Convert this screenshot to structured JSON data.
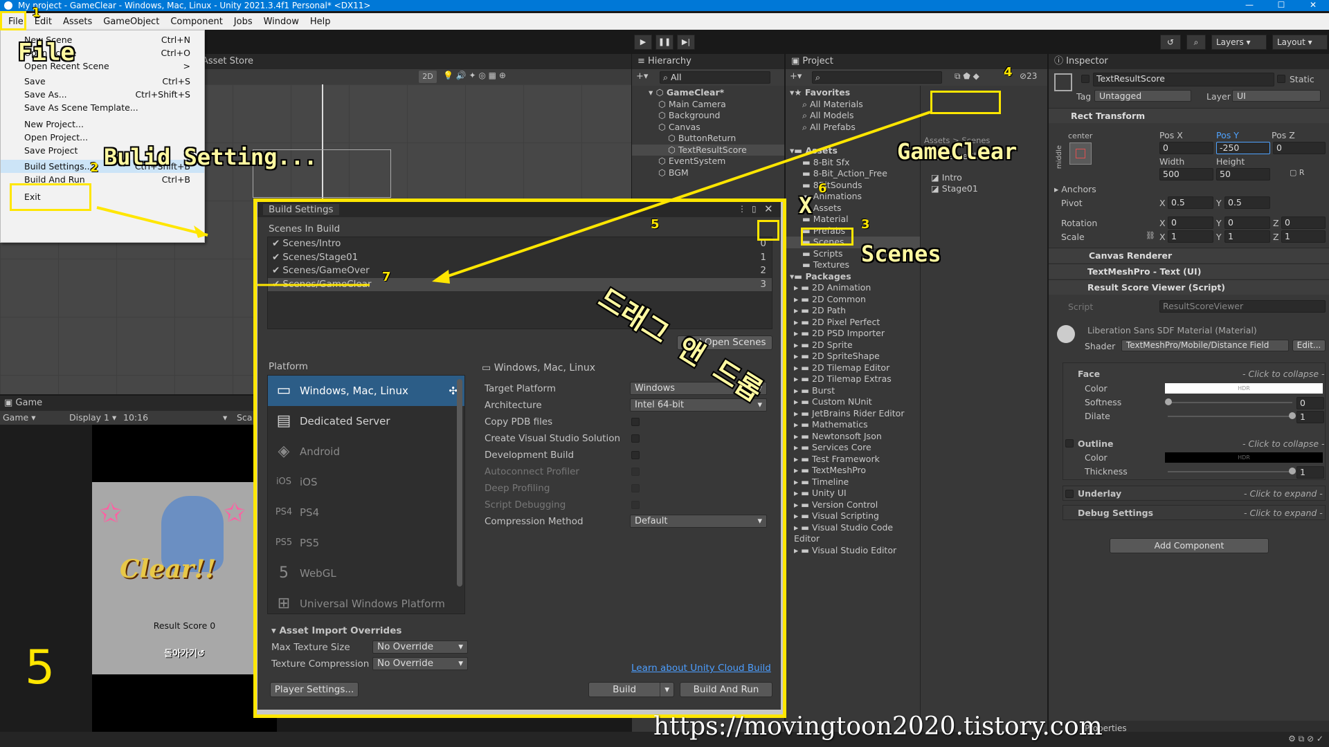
{
  "window": {
    "title": "My project - GameClear - Windows, Mac, Linux - Unity 2021.3.4f1 Personal* <DX11>"
  },
  "menu": [
    "File",
    "Edit",
    "Assets",
    "GameObject",
    "Component",
    "Jobs",
    "Window",
    "Help"
  ],
  "file_menu": {
    "items": [
      {
        "label": "New Scene",
        "shortcut": "Ctrl+N"
      },
      {
        "label": "Open Scene",
        "shortcut": "Ctrl+O"
      },
      {
        "label": "Open Recent Scene",
        "shortcut": ">"
      },
      {
        "label": "Save",
        "shortcut": "Ctrl+S"
      },
      {
        "label": "Save As...",
        "shortcut": "Ctrl+Shift+S"
      },
      {
        "label": "Save As Scene Template...",
        "shortcut": ""
      },
      {
        "label": "New Project...",
        "shortcut": ""
      },
      {
        "label": "Open Project...",
        "shortcut": ""
      },
      {
        "label": "Save Project",
        "shortcut": ""
      },
      {
        "label": "Build Settings...",
        "shortcut": "Ctrl+Shift+B"
      },
      {
        "label": "Build And Run",
        "shortcut": "Ctrl+B"
      },
      {
        "label": "Exit",
        "shortcut": ""
      }
    ]
  },
  "toolbar": {
    "layers": "Layers",
    "layout": "Layout"
  },
  "scene": {
    "asset_store_tab": "Asset Store",
    "mode_2d": "2D"
  },
  "hierarchy": {
    "tab": "Hierarchy",
    "search": "All",
    "items": [
      {
        "label": "GameClear*",
        "depth": 0
      },
      {
        "label": "Main Camera",
        "depth": 1
      },
      {
        "label": "Background",
        "depth": 1
      },
      {
        "label": "Canvas",
        "depth": 1
      },
      {
        "label": "ButtonReturn",
        "depth": 2
      },
      {
        "label": "TextResultScore",
        "depth": 2
      },
      {
        "label": "EventSystem",
        "depth": 1
      },
      {
        "label": "BGM",
        "depth": 1
      }
    ]
  },
  "project": {
    "tab": "Project",
    "count": "23",
    "breadcrumb": "Assets > Scenes",
    "favorites": [
      "Favorites",
      "All Materials",
      "All Models",
      "All Prefabs"
    ],
    "assets_root": "Assets",
    "assets": [
      "8-Bit Sfx",
      "8-Bit_Action_Free",
      "8BitSounds",
      "Animations",
      "Assets",
      "Material",
      "Prefabs",
      "Scenes",
      "Scripts",
      "Textures"
    ],
    "packages_root": "Packages",
    "packages": [
      "2D Animation",
      "2D Common",
      "2D Path",
      "2D Pixel Perfect",
      "2D PSD Importer",
      "2D Sprite",
      "2D SpriteShape",
      "2D Tilemap Editor",
      "2D Tilemap Extras",
      "Burst",
      "Custom NUnit",
      "JetBrains Rider Editor",
      "Mathematics",
      "Newtonsoft Json",
      "Services Core",
      "Test Framework",
      "TextMeshPro",
      "Timeline",
      "Unity UI",
      "Version Control",
      "Visual Scripting",
      "Visual Studio Code Editor",
      "Visual Studio Editor"
    ],
    "scene_files": [
      "GameClear",
      "Intro",
      "Stage01"
    ]
  },
  "inspector": {
    "tab": "Inspector",
    "object_name": "TextResultScore",
    "static": "Static",
    "tag_label": "Tag",
    "tag": "Untagged",
    "layer_label": "Layer",
    "layer": "UI",
    "rect_transform": "Rect Transform",
    "anchor_h": "center",
    "anchor_v": "middle",
    "pos_x_label": "Pos X",
    "pos_y_label": "Pos Y",
    "pos_z_label": "Pos Z",
    "pos_x": "0",
    "pos_y": "-250",
    "pos_z": "0",
    "width_label": "Width",
    "height_label": "Height",
    "width": "500",
    "height": "50",
    "anchors": "Anchors",
    "pivot": "Pivot",
    "pivot_x": "0.5",
    "pivot_y": "0.5",
    "rotation": "Rotation",
    "rot_x": "0",
    "rot_y": "0",
    "rot_z": "0",
    "scale": "Scale",
    "scale_x": "1",
    "scale_y": "1",
    "scale_z": "1",
    "canvas_renderer": "Canvas Renderer",
    "tmp": "TextMeshPro - Text (UI)",
    "result_viewer": "Result Score Viewer (Script)",
    "script_label": "Script",
    "script": "ResultScoreViewer",
    "material": "Liberation Sans SDF Material (Material)",
    "shader_label": "Shader",
    "shader": "TextMeshPro/Mobile/Distance Field",
    "edit": "Edit...",
    "face": "Face",
    "collapse": "- Click to collapse -",
    "expand": "- Click to expand -",
    "color": "Color",
    "hdr": "HDR",
    "softness": "Softness",
    "softness_val": "0",
    "dilate": "Dilate",
    "dilate_val": "1",
    "outline": "Outline",
    "thickness": "Thickness",
    "thickness_val": "1",
    "underlay": "Underlay",
    "debug": "Debug Settings",
    "add_component": "Add Component",
    "properties": "Properties"
  },
  "game": {
    "tab": "Game",
    "mode": "Game",
    "display": "Display 1",
    "ratio": "10:16",
    "scale": "Sca",
    "clear_text": "Clear!!",
    "result": "Result Score 0",
    "back": "돌아가기↺"
  },
  "build_settings": {
    "title": "Build Settings",
    "scenes_header": "Scenes In Build",
    "scenes": [
      {
        "name": "Scenes/Intro",
        "index": "0"
      },
      {
        "name": "Scenes/Stage01",
        "index": "1"
      },
      {
        "name": "Scenes/GameOver",
        "index": "2"
      },
      {
        "name": "Scenes/GameClear",
        "index": "3"
      }
    ],
    "add_open_scenes": "Add Open Scenes",
    "platform_header": "Platform",
    "platforms": [
      {
        "icon": "▭",
        "name": "Windows, Mac, Linux"
      },
      {
        "icon": "▤",
        "name": "Dedicated Server"
      },
      {
        "icon": "◈",
        "name": "Android"
      },
      {
        "icon": "iOS",
        "name": "iOS"
      },
      {
        "icon": "PS4",
        "name": "PS4"
      },
      {
        "icon": "PS5",
        "name": "PS5"
      },
      {
        "icon": "5",
        "name": "WebGL"
      },
      {
        "icon": "⊞",
        "name": "Universal Windows Platform"
      }
    ],
    "selected_platform": "Windows, Mac, Linux",
    "settings": [
      {
        "label": "Target Platform",
        "kind": "dropdown",
        "value": "Windows"
      },
      {
        "label": "Architecture",
        "kind": "dropdown",
        "value": "Intel 64-bit"
      },
      {
        "label": "Copy PDB files",
        "kind": "check",
        "value": ""
      },
      {
        "label": "Create Visual Studio Solution",
        "kind": "check",
        "value": ""
      },
      {
        "label": "Development Build",
        "kind": "check",
        "value": ""
      },
      {
        "label": "Autoconnect Profiler",
        "kind": "check-dim",
        "value": ""
      },
      {
        "label": "Deep Profiling",
        "kind": "check-dim",
        "value": ""
      },
      {
        "label": "Script Debugging",
        "kind": "check-dim",
        "value": ""
      },
      {
        "label": "Compression Method",
        "kind": "dropdown",
        "value": "Default"
      }
    ],
    "overrides_header": "Asset Import Overrides",
    "max_texture_label": "Max Texture Size",
    "max_texture": "No Override",
    "tex_compression_label": "Texture Compression",
    "tex_compression": "No Override",
    "cloud_link": "Learn about Unity Cloud Build",
    "player_settings": "Player Settings...",
    "build": "Build",
    "build_and_run": "Build And Run"
  },
  "annotations": {
    "file": "File",
    "build_setting": "Bulid Setting...",
    "gameclear": "GameClear",
    "scenes": "Scenes",
    "drag": "드래그 앤 드롭",
    "x": "X",
    "step_big": "5",
    "n1": "1",
    "n2": "2",
    "n3": "3",
    "n4": "4",
    "n5": "5",
    "n6": "6",
    "n7": "7",
    "url": "https://movingtoon2020.tistory.com"
  }
}
